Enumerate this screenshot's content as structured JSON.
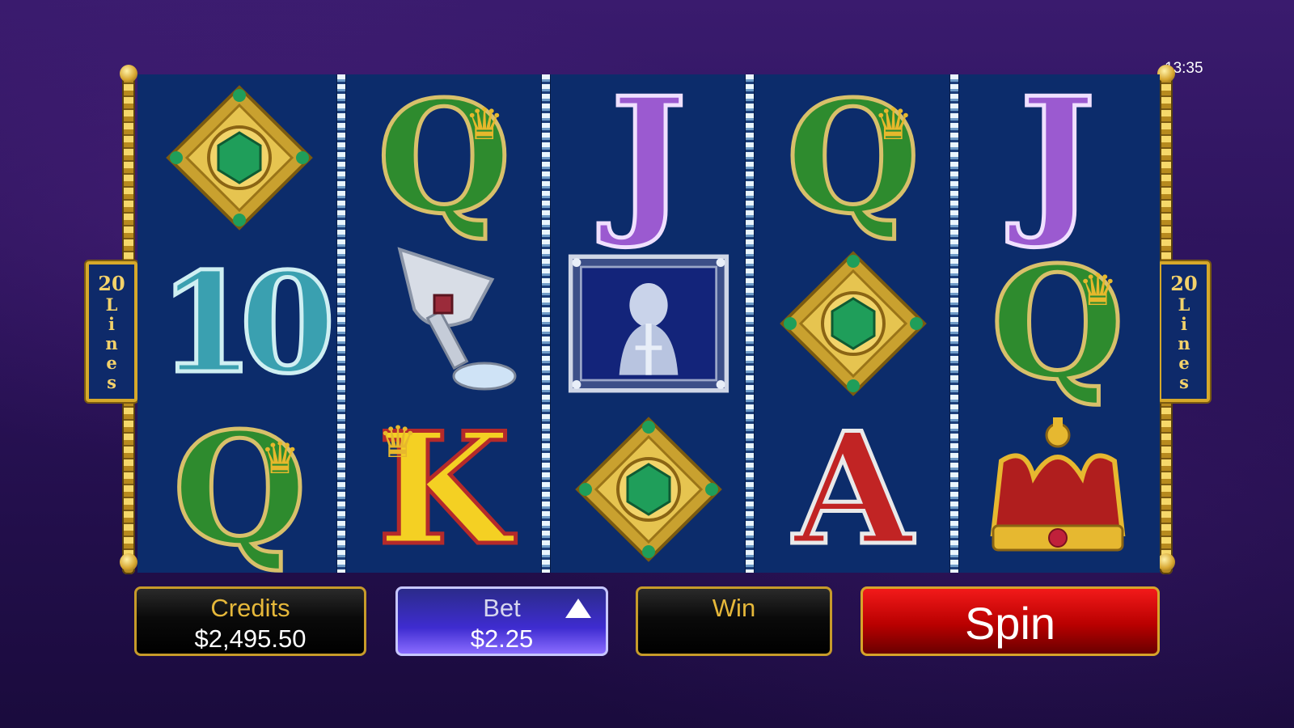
{
  "clock": "13:35",
  "lines_badge": {
    "number": "20",
    "word_letters": [
      "L",
      "i",
      "n",
      "e",
      "s"
    ]
  },
  "reels": [
    {
      "symbols": [
        "emerald-brooch",
        "10",
        "Q"
      ]
    },
    {
      "symbols": [
        "Q",
        "silver-chalice",
        "K"
      ]
    },
    {
      "symbols": [
        "J",
        "lady-of-the-lake",
        "emerald-brooch"
      ]
    },
    {
      "symbols": [
        "Q",
        "emerald-brooch",
        "A"
      ]
    },
    {
      "symbols": [
        "J",
        "Q",
        "royal-crown"
      ]
    }
  ],
  "controls": {
    "credits_label": "Credits",
    "credits_value": "$2,495.50",
    "bet_label": "Bet",
    "bet_value": "$2.25",
    "win_label": "Win",
    "win_value": "",
    "spin_label": "Spin"
  },
  "colors": {
    "reel_bg": "#0c2c6b",
    "gold": "#d6a92b",
    "spin_red": "#d10000",
    "bet_blue": "#3e2cd0"
  }
}
